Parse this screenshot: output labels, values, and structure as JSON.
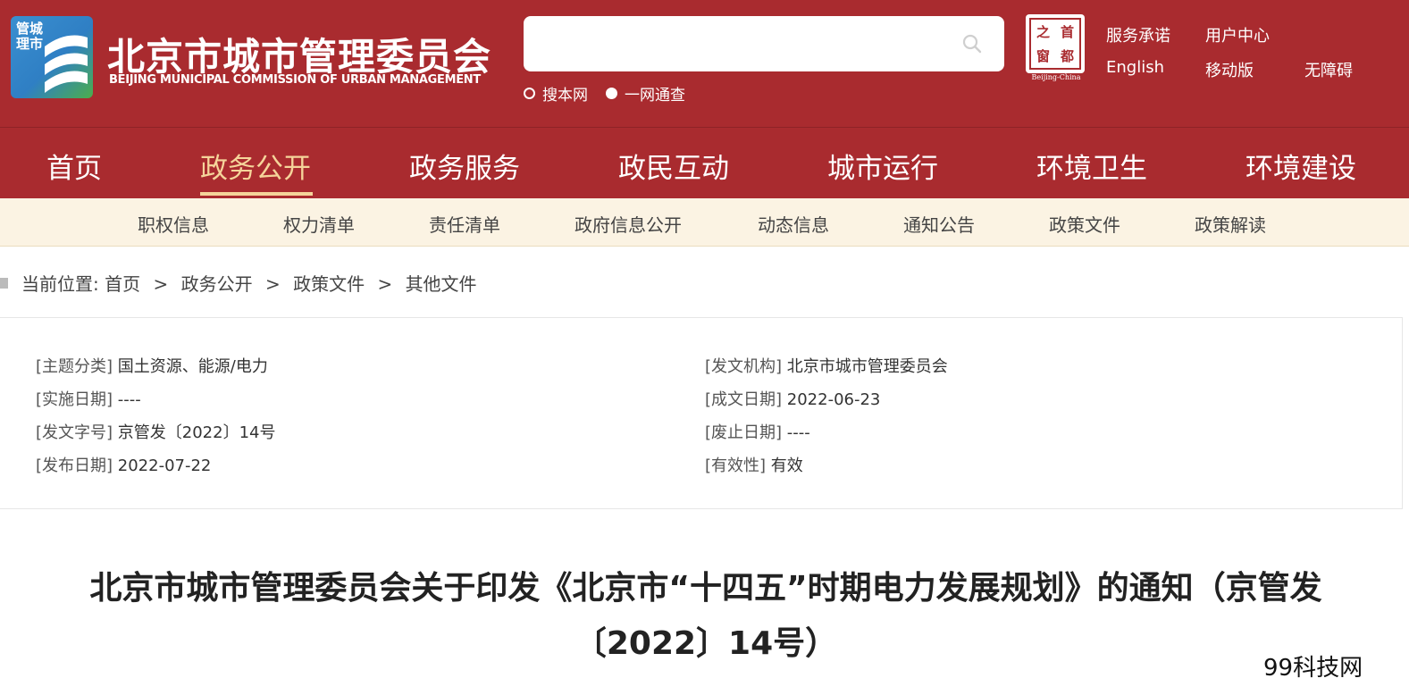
{
  "header": {
    "logo_badge_text": "管城理市",
    "site_title": "北京市城市管理委员会",
    "site_subtitle": "BEIJING MUNICIPAL COMMISSION OF URBAN MANAGEMENT",
    "search": {
      "placeholder": "",
      "value": ""
    },
    "search_scopes": [
      {
        "label": "搜本网",
        "selected": false
      },
      {
        "label": "一网通查",
        "selected": true
      }
    ],
    "seal": {
      "chars": [
        "之",
        "首",
        "窗",
        "都"
      ],
      "caption": "Beijing-China"
    },
    "links": [
      "服务承诺",
      "用户中心",
      "English",
      "移动版",
      "无障碍"
    ]
  },
  "main_nav": {
    "items": [
      "首页",
      "政务公开",
      "政务服务",
      "政民互动",
      "城市运行",
      "环境卫生",
      "环境建设"
    ],
    "active": "政务公开"
  },
  "sub_nav": {
    "items": [
      "职权信息",
      "权力清单",
      "责任清单",
      "政府信息公开",
      "动态信息",
      "通知公告",
      "政策文件",
      "政策解读"
    ]
  },
  "breadcrumb": {
    "prefix": "当前位置:",
    "items": [
      "首页",
      "政务公开",
      "政策文件",
      "其他文件"
    ],
    "separator": ">"
  },
  "doc_info": {
    "left": [
      {
        "key": "[主题分类]",
        "value": "国土资源、能源/电力"
      },
      {
        "key": "[实施日期]",
        "value": "----"
      },
      {
        "key": "[发文字号]",
        "value": "京管发〔2022〕14号"
      },
      {
        "key": "[发布日期]",
        "value": "2022-07-22"
      }
    ],
    "right": [
      {
        "key": "[发文机构]",
        "value": "北京市城市管理委员会"
      },
      {
        "key": "[成文日期]",
        "value": "2022-06-23"
      },
      {
        "key": "[废止日期]",
        "value": "----"
      },
      {
        "key": "[有效性]",
        "value": "有效"
      }
    ]
  },
  "document": {
    "title_line1": "北京市城市管理委员会关于印发《北京市“十四五”时期电力发展规划》的通知（京管发",
    "title_line2": "〔2022〕14号）"
  },
  "watermark": "99科技网",
  "colors": {
    "brand_red": "#a92b2f",
    "active_gold": "#f5d49a",
    "subnav_bg": "#fbf3e3"
  }
}
